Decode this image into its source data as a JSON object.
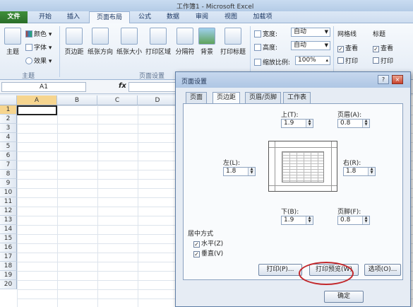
{
  "window": {
    "title": "工作簿1 - Microsoft Excel"
  },
  "tabs": [
    "文件",
    "开始",
    "插入",
    "页面布局",
    "公式",
    "数据",
    "审阅",
    "视图",
    "加载项"
  ],
  "ribbon": {
    "theme_group": {
      "main": "主题",
      "colors": "颜色",
      "fonts": "字体",
      "effects": "效果",
      "label": "主题"
    },
    "page_setup_group": {
      "buttons": [
        "页边距",
        "纸张方向",
        "纸张大小",
        "打印区域",
        "分隔符",
        "背景",
        "打印标题"
      ],
      "label": "页面设置"
    },
    "scale_group": {
      "width_label": "宽度:",
      "width_value": "自动",
      "height_label": "高度:",
      "height_value": "自动",
      "scale_label": "缩放比例:",
      "scale_value": "100%"
    },
    "gridlines": {
      "title": "网格线",
      "view": "查看",
      "print": "打印"
    },
    "headings": {
      "title": "标题",
      "view": "查看",
      "print": "打印"
    }
  },
  "formula_bar": {
    "name_box": "A1",
    "fx": "fx"
  },
  "grid": {
    "columns": [
      "A",
      "B",
      "C",
      "D"
    ],
    "rows": [
      "1",
      "2",
      "3",
      "4",
      "5",
      "6",
      "7",
      "8",
      "9",
      "10",
      "11",
      "12",
      "13",
      "14",
      "15",
      "16",
      "17",
      "18",
      "19",
      "20"
    ]
  },
  "dialog": {
    "title": "页面设置",
    "help": "?",
    "close": "×",
    "tabs": [
      "页面",
      "页边距",
      "页眉/页脚",
      "工作表"
    ],
    "top_label": "上(T):",
    "top_value": "1.9",
    "header_label": "页眉(A):",
    "header_value": "0.8",
    "left_label": "左(L):",
    "left_value": "1.8",
    "right_label": "右(R):",
    "right_value": "1.8",
    "bottom_label": "下(B):",
    "bottom_value": "1.9",
    "footer_label": "页脚(F):",
    "footer_value": "0.8",
    "center_title": "居中方式",
    "horizontal": "水平(Z)",
    "vertical": "垂直(V)",
    "print_btn": "打印(P)...",
    "preview_btn": "打印预览(W)",
    "options_btn": "选项(O)...",
    "ok_btn": "确定"
  }
}
